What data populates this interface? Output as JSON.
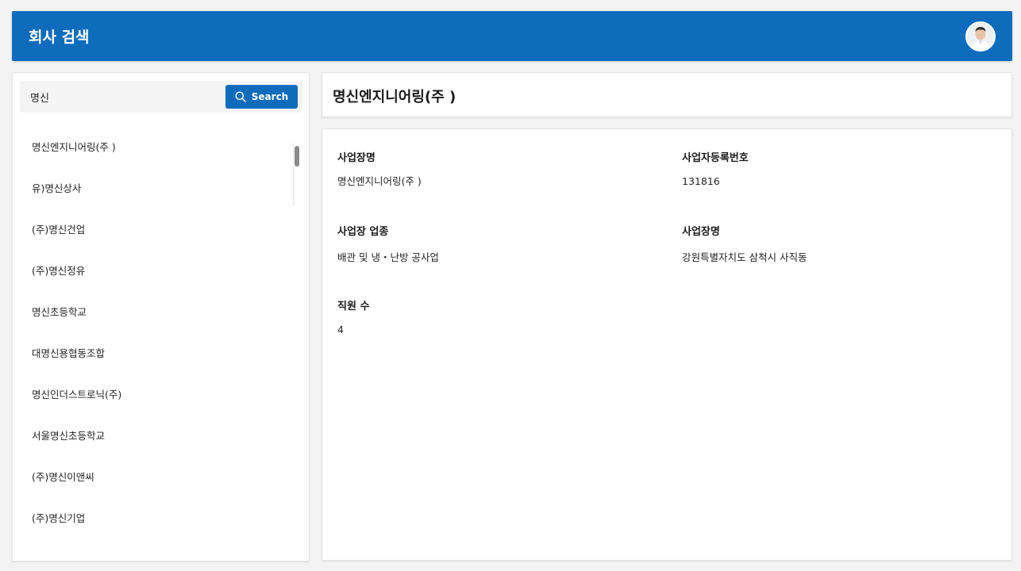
{
  "header": {
    "title": "회사 검색",
    "avatar_icon": "user-avatar-icon",
    "background_color": "#0f6cbd"
  },
  "search": {
    "value": "명신",
    "button_label": "Search",
    "button_icon": "search-icon"
  },
  "company_list": [
    "명신엔지니어링(주 )",
    "유)명신상사",
    "(주)명신건업",
    "(주)명신정유",
    "명신초등학교",
    "대명신용협동조합",
    "명신인더스트로닉(주)",
    "서울명신초등학교",
    "(주)명신이앤씨",
    "(주)명신기업"
  ],
  "detail": {
    "title": "명신엔지니어링(주 )",
    "fields": {
      "business_name": {
        "label": "사업장명",
        "value": "명신엔지니어링(주 )"
      },
      "registration_no": {
        "label": "사업자등록번호",
        "value": "131816"
      },
      "industry": {
        "label": "사업장 업종",
        "value": "배관 및 냉・난방 공사업"
      },
      "location": {
        "label": "사업장명",
        "value": "강원특별자치도 삼척시 사직동"
      },
      "employees": {
        "label": "직원 수",
        "value": "4"
      }
    }
  }
}
